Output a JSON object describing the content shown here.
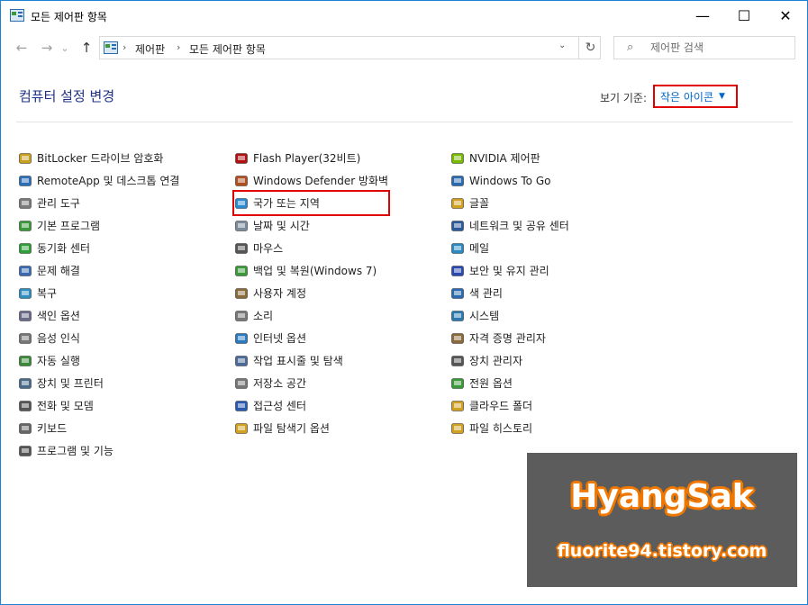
{
  "window": {
    "title": "모든 제어판 항목",
    "minimize": "—",
    "maximize": "☐",
    "close": "✕"
  },
  "nav": {
    "back": "←",
    "forward": "→",
    "recent": "⌄",
    "up": "↑"
  },
  "address": {
    "crumbs": [
      "제어판",
      "모든 제어판 항목"
    ],
    "separator": "›",
    "dropdown": "⌄",
    "refresh": "↻"
  },
  "search": {
    "placeholder": "제어판 검색",
    "icon": "⌕"
  },
  "header": {
    "title": "컴퓨터 설정 변경",
    "view_label": "보기 기준:",
    "view_value": "작은 아이콘",
    "view_arrow": "▼"
  },
  "columns": [
    [
      {
        "label": "BitLocker 드라이브 암호화",
        "icon": "bitlocker-icon",
        "color": "#c8a020"
      },
      {
        "label": "RemoteApp 및 데스크톱 연결",
        "icon": "remoteapp-icon",
        "color": "#2a6fb8"
      },
      {
        "label": "관리 도구",
        "icon": "admin-tools-icon",
        "color": "#7a7a7a"
      },
      {
        "label": "기본 프로그램",
        "icon": "default-programs-icon",
        "color": "#3a9a3a"
      },
      {
        "label": "동기화 센터",
        "icon": "sync-center-icon",
        "color": "#2e9e3a"
      },
      {
        "label": "문제 해결",
        "icon": "troubleshoot-icon",
        "color": "#3a6ab0"
      },
      {
        "label": "복구",
        "icon": "recovery-icon",
        "color": "#2e8ec0"
      },
      {
        "label": "색인 옵션",
        "icon": "indexing-icon",
        "color": "#6a6a8a"
      },
      {
        "label": "음성 인식",
        "icon": "speech-icon",
        "color": "#777777"
      },
      {
        "label": "자동 실행",
        "icon": "autoplay-icon",
        "color": "#3a8a3a"
      },
      {
        "label": "장치 및 프린터",
        "icon": "devices-printers-icon",
        "color": "#4a6a8a"
      },
      {
        "label": "전화 및 모뎀",
        "icon": "phone-modem-icon",
        "color": "#555555"
      },
      {
        "label": "키보드",
        "icon": "keyboard-icon",
        "color": "#666666"
      },
      {
        "label": "프로그램 및 기능",
        "icon": "programs-features-icon",
        "color": "#555555"
      }
    ],
    [
      {
        "label": "Flash Player(32비트)",
        "icon": "flash-icon",
        "color": "#b01010"
      },
      {
        "label": "Windows Defender 방화벽",
        "icon": "firewall-icon",
        "color": "#b05020"
      },
      {
        "label": "국가 또는 지역",
        "icon": "region-icon",
        "color": "#2a8ad0",
        "highlight": true
      },
      {
        "label": "날짜 및 시간",
        "icon": "date-time-icon",
        "color": "#7a8a9a"
      },
      {
        "label": "마우스",
        "icon": "mouse-icon",
        "color": "#555555"
      },
      {
        "label": "백업 및 복원(Windows 7)",
        "icon": "backup-icon",
        "color": "#3a9a3a"
      },
      {
        "label": "사용자 계정",
        "icon": "user-accounts-icon",
        "color": "#8a6a3a"
      },
      {
        "label": "소리",
        "icon": "sound-icon",
        "color": "#777777"
      },
      {
        "label": "인터넷 옵션",
        "icon": "internet-options-icon",
        "color": "#2a7ac0"
      },
      {
        "label": "작업 표시줄 및 탐색",
        "icon": "taskbar-icon",
        "color": "#4a6a9a"
      },
      {
        "label": "저장소 공간",
        "icon": "storage-spaces-icon",
        "color": "#777777"
      },
      {
        "label": "접근성 센터",
        "icon": "ease-of-access-icon",
        "color": "#2a5ab0"
      },
      {
        "label": "파일 탐색기 옵션",
        "icon": "explorer-options-icon",
        "color": "#d0a020"
      }
    ],
    [
      {
        "label": "NVIDIA 제어판",
        "icon": "nvidia-icon",
        "color": "#76b900"
      },
      {
        "label": "Windows To Go",
        "icon": "windows-to-go-icon",
        "color": "#2a6ab0"
      },
      {
        "label": "글꼴",
        "icon": "fonts-icon",
        "color": "#d0a020"
      },
      {
        "label": "네트워크 및 공유 센터",
        "icon": "network-icon",
        "color": "#2a5a9a"
      },
      {
        "label": "메일",
        "icon": "mail-icon",
        "color": "#2a8ac0"
      },
      {
        "label": "보안 및 유지 관리",
        "icon": "security-maintenance-icon",
        "color": "#2a4ab0"
      },
      {
        "label": "색 관리",
        "icon": "color-management-icon",
        "color": "#2a6ab0"
      },
      {
        "label": "시스템",
        "icon": "system-icon",
        "color": "#2a7ab0"
      },
      {
        "label": "자격 증명 관리자",
        "icon": "credential-manager-icon",
        "color": "#8a6a3a"
      },
      {
        "label": "장치 관리자",
        "icon": "device-manager-icon",
        "color": "#555555"
      },
      {
        "label": "전원 옵션",
        "icon": "power-options-icon",
        "color": "#3a9a3a"
      },
      {
        "label": "클라우드 폴더",
        "icon": "work-folders-icon",
        "color": "#d0a020"
      },
      {
        "label": "파일 히스토리",
        "icon": "file-history-icon",
        "color": "#d0a020"
      }
    ]
  ],
  "watermark": {
    "name": "HyangSak",
    "url": "fluorite94.tistory.com"
  }
}
